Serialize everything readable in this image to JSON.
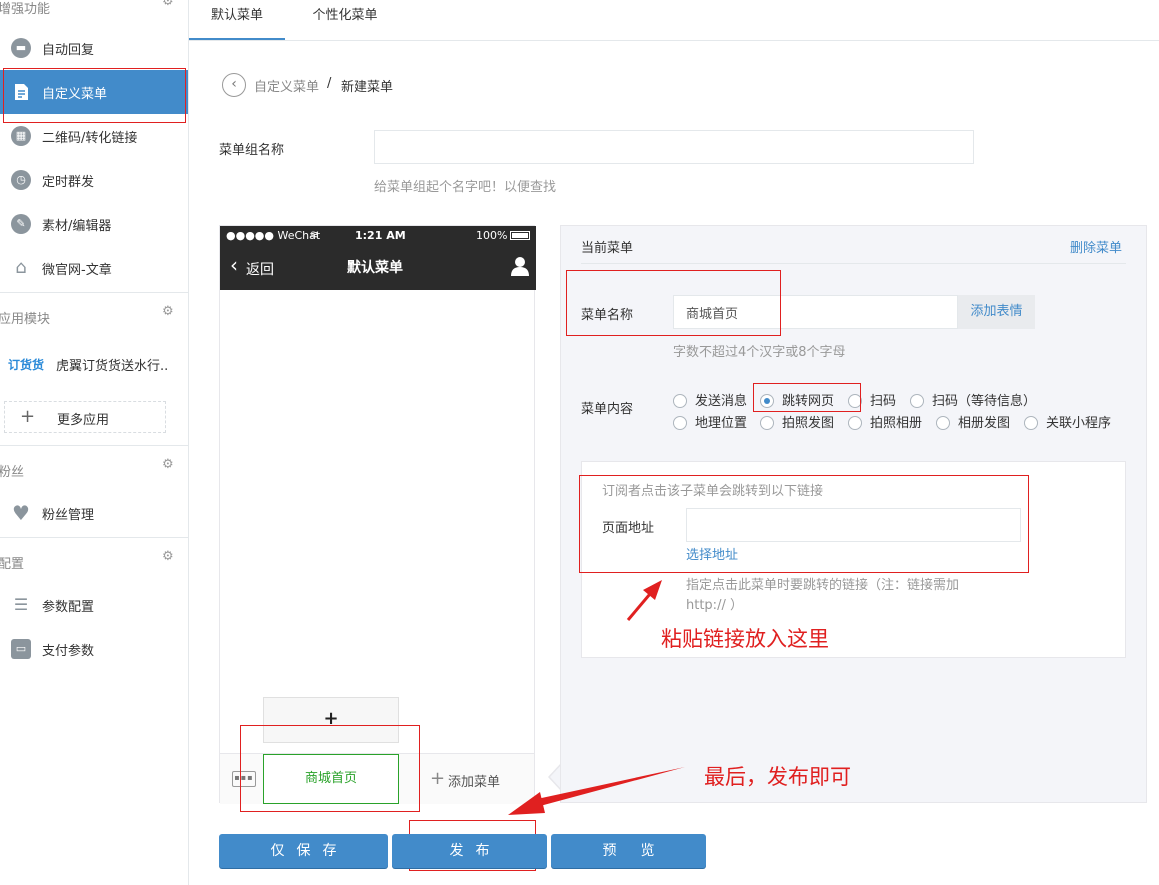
{
  "sidebar": {
    "sections": [
      {
        "title": "增强功能"
      },
      {
        "title": "应用模块"
      },
      {
        "title": "粉丝"
      },
      {
        "title": "配置"
      }
    ],
    "items": [
      {
        "label": "自动回复",
        "icon": "chat-icon"
      },
      {
        "label": "自定义菜单",
        "icon": "document-edit-icon"
      },
      {
        "label": "二维码/转化链接",
        "icon": "qrcode-icon"
      },
      {
        "label": "定时群发",
        "icon": "clock-icon"
      },
      {
        "label": "素材/编辑器",
        "icon": "pencil-icon"
      },
      {
        "label": "微官网-文章",
        "icon": "home-icon"
      },
      {
        "label": "虎翼订货货送水行..",
        "icon": "app-logo-icon",
        "logo_text": "订货货"
      },
      {
        "label": "更多应用",
        "icon": "plus-icon"
      },
      {
        "label": "粉丝管理",
        "icon": "heart-icon"
      },
      {
        "label": "参数配置",
        "icon": "list-icon"
      },
      {
        "label": "支付参数",
        "icon": "wallet-icon"
      }
    ]
  },
  "tabs": [
    {
      "label": "默认菜单"
    },
    {
      "label": "个性化菜单"
    }
  ],
  "breadcrumb": {
    "parent": "自定义菜单",
    "separator": "/",
    "current": "新建菜单"
  },
  "menu_group": {
    "label": "菜单组名称",
    "value": "",
    "hint": "给菜单组起个名字吧！以便查找"
  },
  "phone": {
    "carrier": "●●●●● WeChat",
    "time": "1:21 AM",
    "battery": "100%",
    "back_label": "返回",
    "title": "默认菜单",
    "submenu_add": "+",
    "menu_item": "商城首页",
    "add_menu": "添加菜单"
  },
  "panel": {
    "title": "当前菜单",
    "delete_link": "删除菜单",
    "name_label": "菜单名称",
    "name_value": "商城首页",
    "emoji_button": "添加表情",
    "name_hint": "字数不超过4个汉字或8个字母",
    "content_label": "菜单内容",
    "content_options": [
      {
        "label": "发送消息",
        "selected": false
      },
      {
        "label": "跳转网页",
        "selected": true
      },
      {
        "label": "扫码",
        "selected": false
      },
      {
        "label": "扫码（等待信息）",
        "selected": false
      },
      {
        "label": "地理位置",
        "selected": false
      },
      {
        "label": "拍照发图",
        "selected": false
      },
      {
        "label": "拍照相册",
        "selected": false
      },
      {
        "label": "相册发图",
        "selected": false
      },
      {
        "label": "关联小程序",
        "selected": false
      }
    ],
    "link_info": "订阅者点击该子菜单会跳转到以下链接",
    "url_label": "页面地址",
    "url_value": "",
    "choose_link": "选择地址",
    "url_hint_1": "指定点击此菜单时要跳转的链接（注：链接需加",
    "url_hint_2": "http:// ）"
  },
  "annotations": {
    "paste_link": "粘贴链接放入这里",
    "publish_tip": "最后，发布即可"
  },
  "buttons": {
    "save": "仅保存",
    "publish": "发布",
    "preview": "预览"
  },
  "colors": {
    "accent": "#428bca",
    "annotation": "#e02020",
    "menu_item_text": "#2aa22a"
  }
}
